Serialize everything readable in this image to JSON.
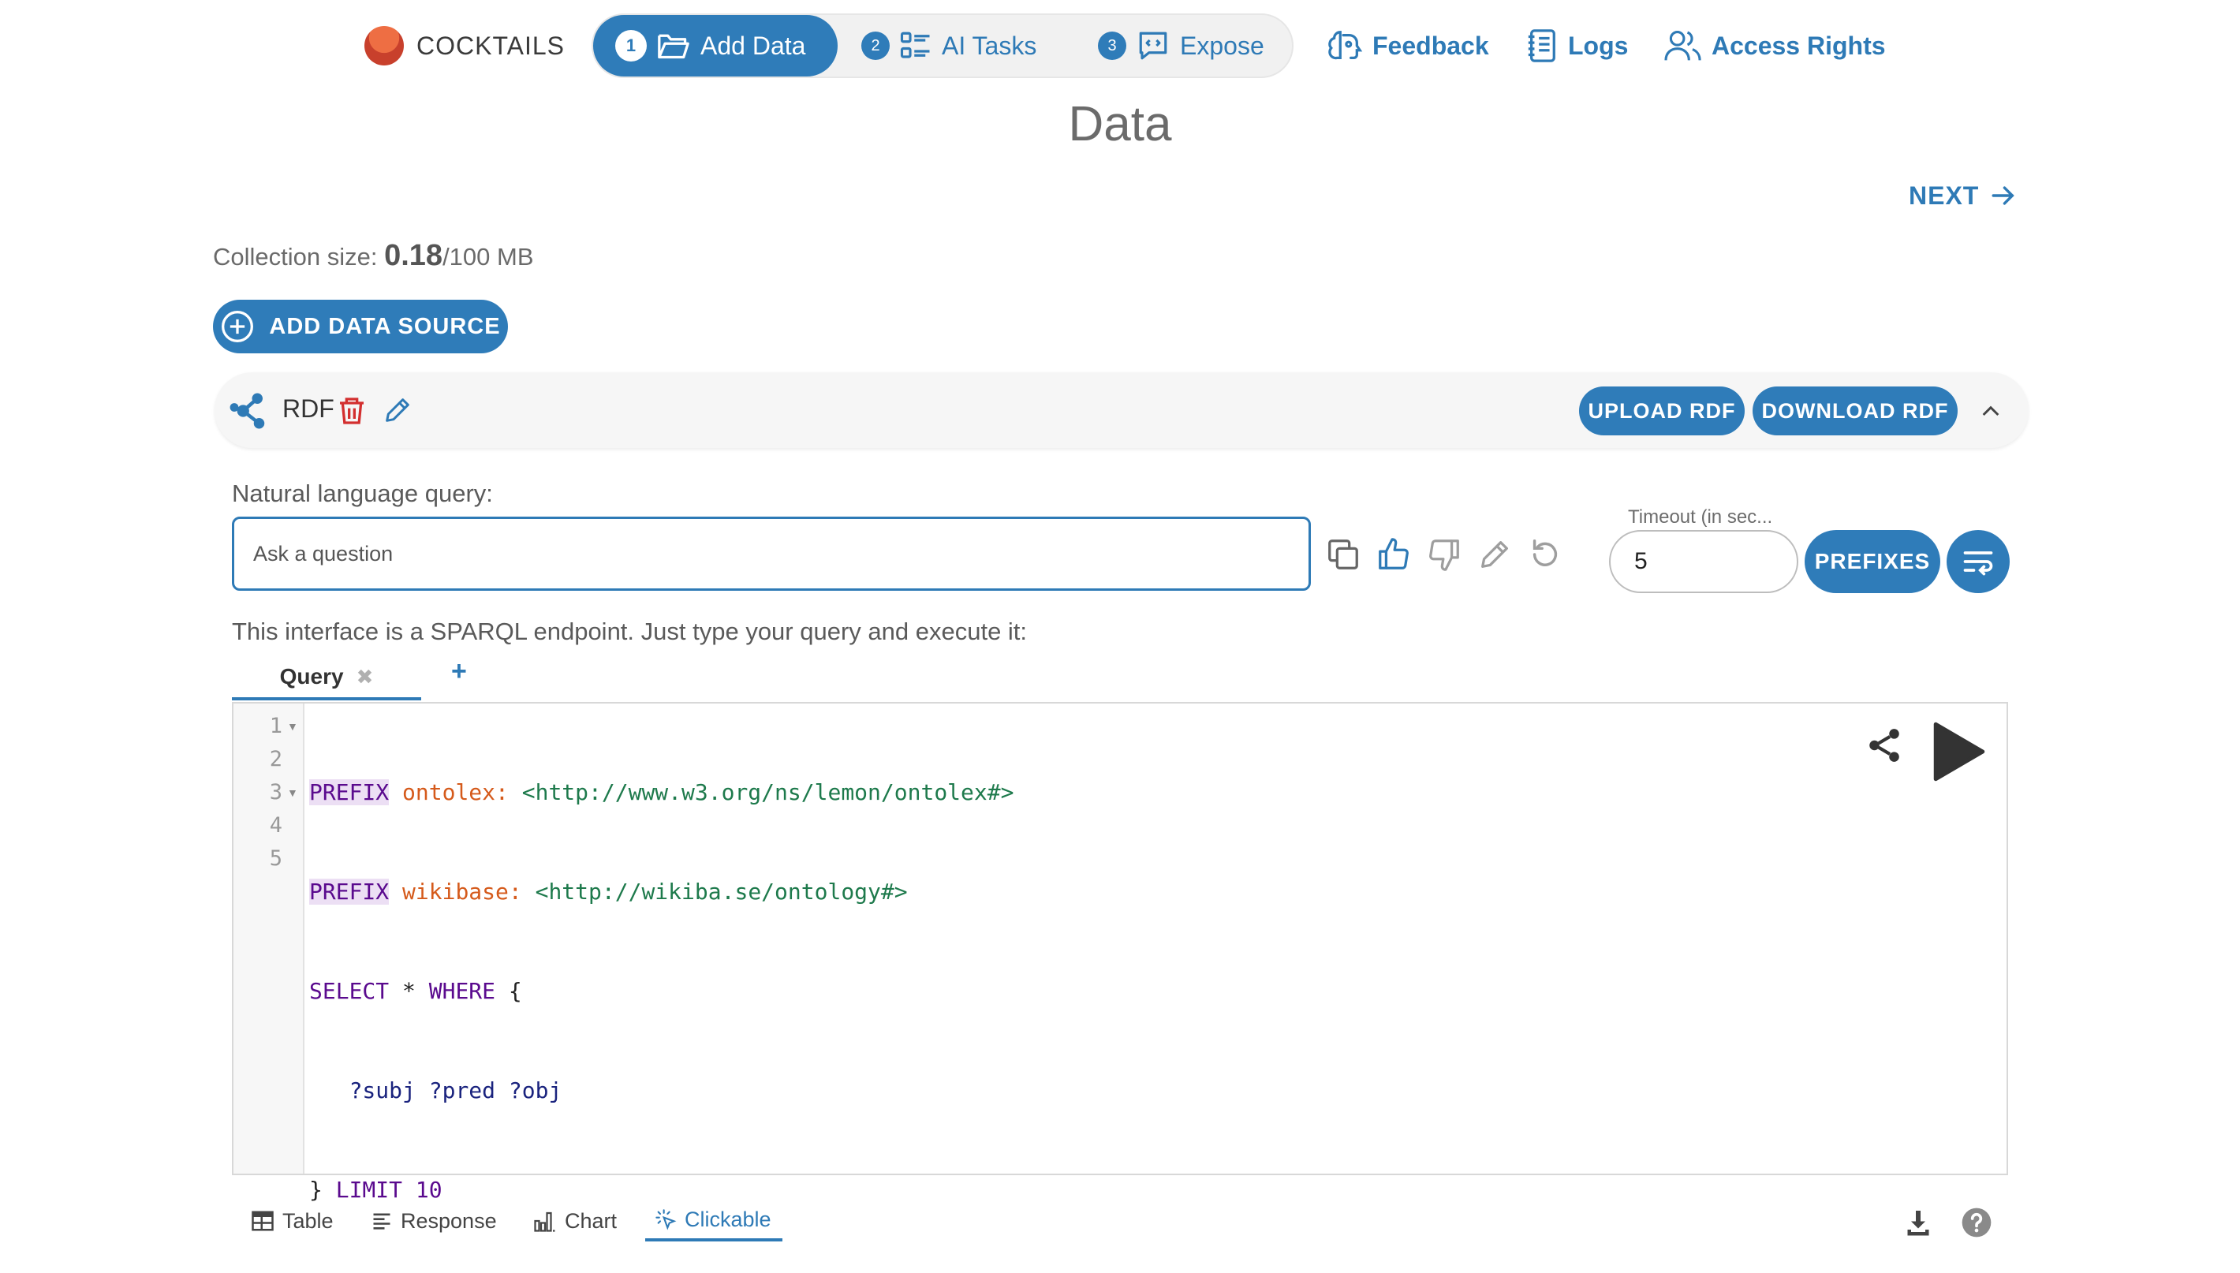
{
  "brand": {
    "name": "COCKTAILS"
  },
  "stepper": {
    "steps": [
      {
        "num": "1",
        "label": "Add Data"
      },
      {
        "num": "2",
        "label": "AI Tasks"
      },
      {
        "num": "3",
        "label": "Expose"
      }
    ]
  },
  "nav": {
    "feedback": "Feedback",
    "logs": "Logs",
    "access_rights": "Access Rights"
  },
  "page": {
    "title": "Data",
    "next": "NEXT"
  },
  "collection": {
    "label": "Collection size: ",
    "used": "0.18",
    "limit": "/100 MB"
  },
  "add_source": "ADD DATA SOURCE",
  "source": {
    "name": "RDF",
    "upload": "UPLOAD RDF",
    "download": "DOWNLOAD RDF"
  },
  "nlq": {
    "label": "Natural language query:",
    "placeholder": "Ask a question"
  },
  "timeout": {
    "label": "Timeout (in sec...",
    "value": "5"
  },
  "prefixes": "PREFIXES",
  "sparql": {
    "hint": "This interface is a SPARQL endpoint. Just type your query and execute it:",
    "tab": "Query",
    "tab_close": "✖",
    "tab_add": "+",
    "lines": {
      "l1": {
        "n": "1",
        "kw": "PREFIX",
        "pfx": "ontolex:",
        "iri": "<http://www.w3.org/ns/lemon/ontolex#>"
      },
      "l2": {
        "n": "2",
        "kw": "PREFIX",
        "pfx": "wikibase:",
        "iri": "<http://wikiba.se/ontology#>"
      },
      "l3": {
        "n": "3",
        "kw1": "SELECT",
        "star": "*",
        "kw2": "WHERE",
        "brace": "{"
      },
      "l4": {
        "n": "4",
        "v1": "?subj",
        "v2": "?pred",
        "v3": "?obj"
      },
      "l5": {
        "n": "5",
        "brace": "}",
        "kw": "LIMIT",
        "num": "10"
      }
    }
  },
  "results": {
    "tabs": [
      "Table",
      "Response",
      "Chart",
      "Clickable"
    ],
    "active": "Clickable"
  },
  "colors": {
    "accent": "#2f7cb9",
    "delete": "#d32f2f"
  }
}
